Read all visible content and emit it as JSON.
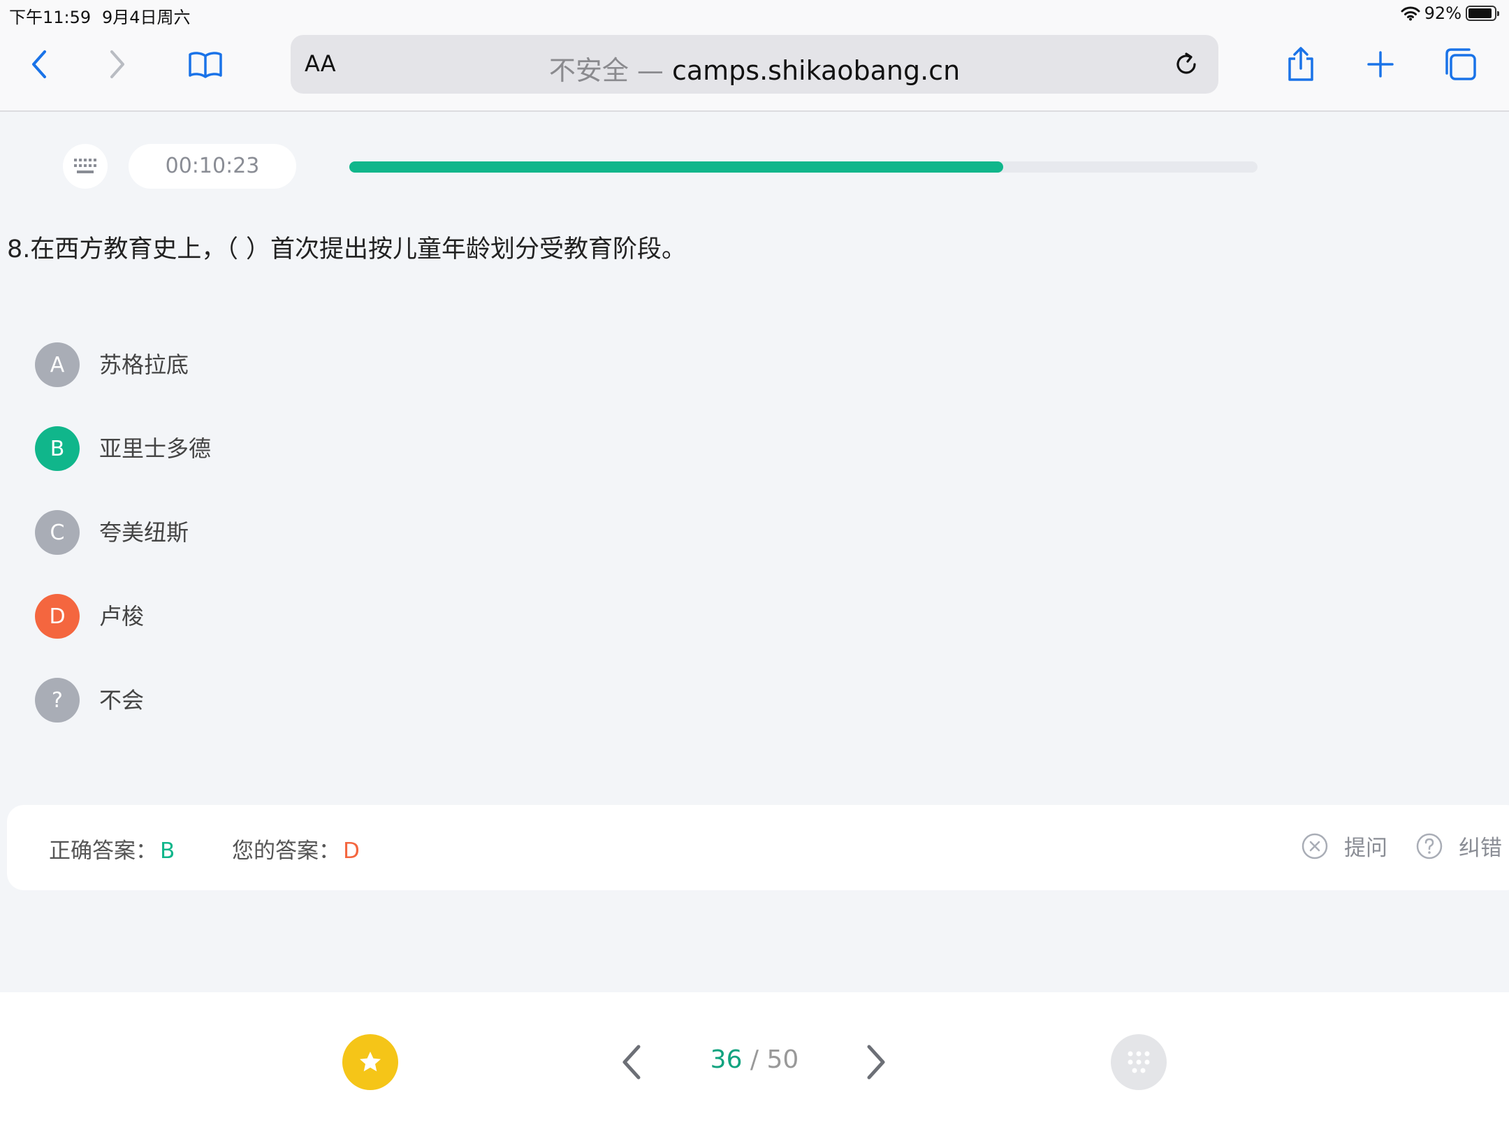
{
  "status_bar": {
    "time": "下午11:59",
    "date": "9月4日周六",
    "battery_text": "92%",
    "battery_level": 0.92,
    "wifi_icon": "wifi-icon"
  },
  "browser": {
    "aa_label": "AA",
    "url_insecure": "不安全 — ",
    "url_host": "camps.shikaobang.cn",
    "accent_color": "#1a73e8"
  },
  "quiz": {
    "timer": "00:10:23",
    "progress": 0.72,
    "question": "8.在西方教育史上，（ ）首次提出按儿童年龄划分受教育阶段。",
    "options": [
      {
        "key": "A",
        "text": "苏格拉底",
        "color": "#a9adb6"
      },
      {
        "key": "B",
        "text": "亚里士多德",
        "color": "#10b68b"
      },
      {
        "key": "C",
        "text": "夸美纽斯",
        "color": "#a9adb6"
      },
      {
        "key": "D",
        "text": "卢梭",
        "color": "#f4663f"
      },
      {
        "key": "?",
        "text": "不会",
        "color": "#a9adb6"
      }
    ],
    "correct_label": "正确答案：",
    "correct_answer": "B",
    "your_label": "您的答案：",
    "your_answer": "D",
    "ask_label": "提问",
    "report_label": "纠错"
  },
  "bottom": {
    "current": "36",
    "separator": " / ",
    "total": "50"
  }
}
